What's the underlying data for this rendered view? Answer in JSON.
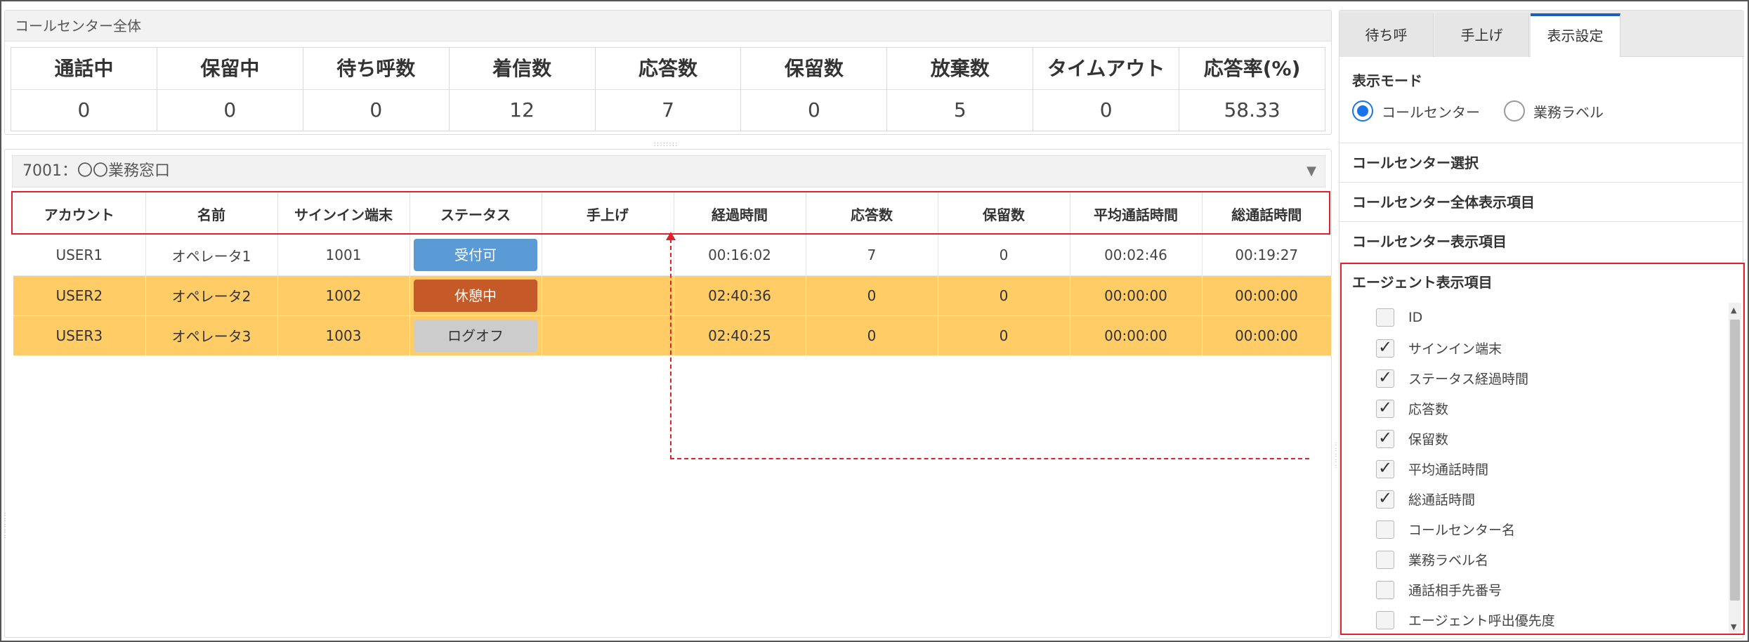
{
  "summary": {
    "title": "コールセンター全体",
    "stats": [
      {
        "label": "通話中",
        "value": "0"
      },
      {
        "label": "保留中",
        "value": "0"
      },
      {
        "label": "待ち呼数",
        "value": "0"
      },
      {
        "label": "着信数",
        "value": "12"
      },
      {
        "label": "応答数",
        "value": "7"
      },
      {
        "label": "保留数",
        "value": "0"
      },
      {
        "label": "放棄数",
        "value": "5"
      },
      {
        "label": "タイムアウト",
        "value": "0"
      },
      {
        "label": "応答率(%)",
        "value": "58.33"
      }
    ]
  },
  "group": {
    "title": "7001：〇〇業務窓口",
    "toggle_icon": "triangle-down-icon"
  },
  "table": {
    "columns": [
      "アカウント",
      "名前",
      "サインイン端末",
      "ステータス",
      "手上げ",
      "経過時間",
      "応答数",
      "保留数",
      "平均通話時間",
      "総通話時間"
    ],
    "rows": [
      {
        "account": "USER1",
        "name": "オペレータ1",
        "terminal": "1001",
        "status": "受付可",
        "status_color": "#5b9bd5",
        "raise": "",
        "elapsed": "00:16:02",
        "answered": "7",
        "held": "0",
        "avg_talk": "00:02:46",
        "total_talk": "00:19:27",
        "highlight": false
      },
      {
        "account": "USER2",
        "name": "オペレータ2",
        "terminal": "1002",
        "status": "休憩中",
        "status_color": "#c55a28",
        "raise": "",
        "elapsed": "02:40:36",
        "answered": "0",
        "held": "0",
        "avg_talk": "00:00:00",
        "total_talk": "00:00:00",
        "highlight": true
      },
      {
        "account": "USER3",
        "name": "オペレータ3",
        "terminal": "1003",
        "status": "ログオフ",
        "status_color": "#cccccc",
        "raise": "",
        "elapsed": "02:40:25",
        "answered": "0",
        "held": "0",
        "avg_talk": "00:00:00",
        "total_talk": "00:00:00",
        "highlight": true
      }
    ],
    "highlight_color": "#ffcc66"
  },
  "right": {
    "tabs": [
      {
        "label": "待ち呼",
        "active": false
      },
      {
        "label": "手上げ",
        "active": false
      },
      {
        "label": "表示設定",
        "active": true
      }
    ],
    "display_mode": {
      "title": "表示モード",
      "options": [
        {
          "label": "コールセンター",
          "selected": true
        },
        {
          "label": "業務ラベル",
          "selected": false
        }
      ]
    },
    "sections": [
      "コールセンター選択",
      "コールセンター全体表示項目",
      "コールセンター表示項目",
      "エージェント表示項目"
    ],
    "agent_items": [
      {
        "label": "ID",
        "checked": false
      },
      {
        "label": "サインイン端末",
        "checked": true
      },
      {
        "label": "ステータス経過時間",
        "checked": true
      },
      {
        "label": "応答数",
        "checked": true
      },
      {
        "label": "保留数",
        "checked": true
      },
      {
        "label": "平均通話時間",
        "checked": true
      },
      {
        "label": "総通話時間",
        "checked": true
      },
      {
        "label": "コールセンター名",
        "checked": false
      },
      {
        "label": "業務ラベル名",
        "checked": false
      },
      {
        "label": "通話相手先番号",
        "checked": false
      },
      {
        "label": "エージェント呼出優先度",
        "checked": false
      }
    ]
  },
  "colors": {
    "accent": "#1a73e8",
    "annotation": "#e0202a"
  }
}
